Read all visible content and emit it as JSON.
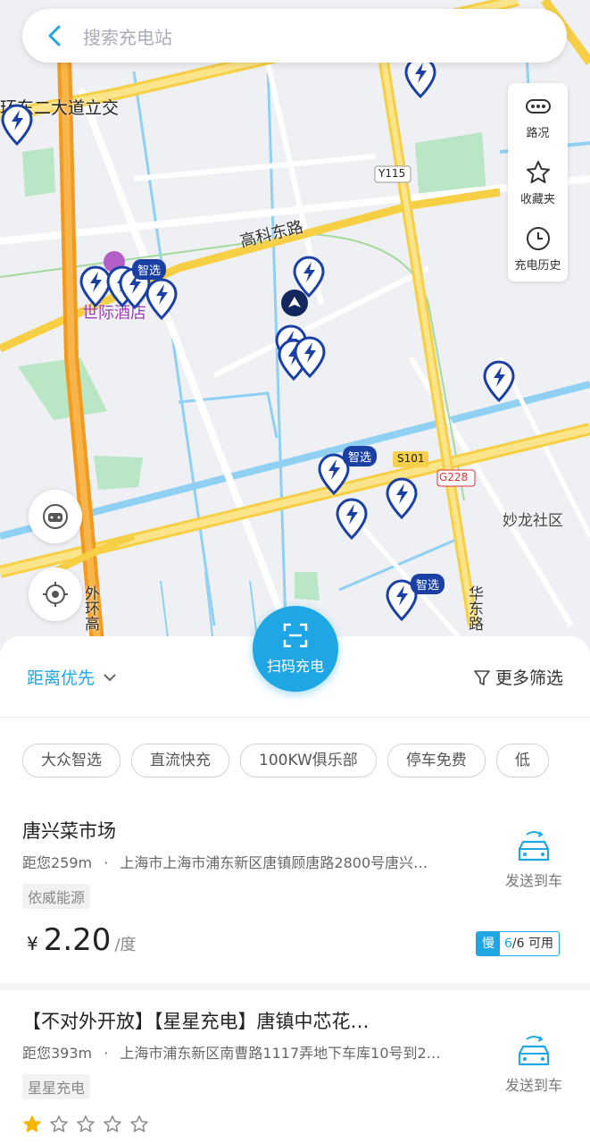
{
  "search": {
    "placeholder": "搜索充电站"
  },
  "map": {
    "labels": {
      "road1": "环东二大道立交",
      "road2": "高科东路",
      "road3": "Y115",
      "road4": "S101",
      "road5": "G228",
      "road6": "妙龙社区",
      "road7": "华东路",
      "road8": "外环高",
      "poi1": "世际酒店"
    },
    "badge": "智选"
  },
  "side_panel": [
    {
      "label": "路况",
      "icon": "traffic-icon"
    },
    {
      "label": "收藏夹",
      "icon": "star-icon"
    },
    {
      "label": "充电历史",
      "icon": "clock-icon"
    }
  ],
  "scan_button": {
    "label": "扫码充电"
  },
  "sort": {
    "label": "距离优先"
  },
  "filter": {
    "label": "更多筛选"
  },
  "chips": [
    "大众智选",
    "直流快充",
    "100KW俱乐部",
    "停车免费",
    "低"
  ],
  "stations": [
    {
      "name": "唐兴菜市场",
      "distance": "距您259m",
      "separator": "·",
      "address": "上海市上海市浦东新区唐镇顾唐路2800号唐兴…",
      "operator": "依威能源",
      "currency": "¥",
      "price": "2.20",
      "unit": "/度",
      "speed": "慢",
      "available": "6",
      "total": "/6 可用",
      "send_label": "发送到车"
    },
    {
      "name": "【不对外开放】【星星充电】唐镇中芯花…",
      "distance": "距您393m",
      "separator": "·",
      "address": "上海市浦东新区南曹路1117弄地下车库10号到2…",
      "operator": "星星充电",
      "rating": 1,
      "rating_max": 5,
      "send_label": "发送到车"
    }
  ],
  "colors": {
    "accent": "#1ea7e4",
    "pin": "#1a3fa5",
    "star": "#f5b400"
  }
}
